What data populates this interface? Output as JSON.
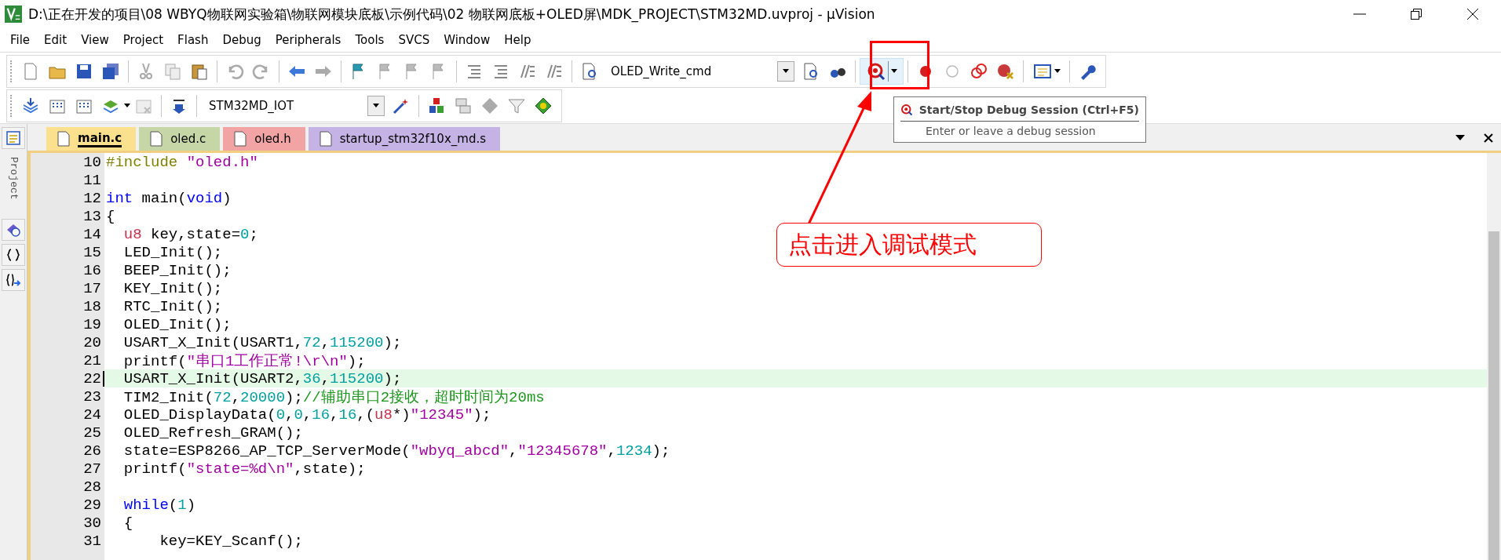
{
  "window": {
    "title": "D:\\正在开发的项目\\08 WBYQ物联网实验箱\\物联网模块底板\\示例代码\\02 物联网底板+OLED屏\\MDK_PROJECT\\STM32MD.uvproj - µVision"
  },
  "menu": [
    "File",
    "Edit",
    "View",
    "Project",
    "Flash",
    "Debug",
    "Peripherals",
    "Tools",
    "SVCS",
    "Window",
    "Help"
  ],
  "toolbar": {
    "find_combo": "OLED_Write_cmd",
    "debug_button": {
      "hovered": true
    }
  },
  "build_toolbar": {
    "target_combo": "STM32MD_IOT"
  },
  "side_panel": {
    "label": "Project"
  },
  "tabs": [
    {
      "label": "main.c",
      "selected": true,
      "color": "#fbe08e"
    },
    {
      "label": "oled.c",
      "selected": false,
      "color": "#c6d6a6"
    },
    {
      "label": "oled.h",
      "selected": false,
      "color": "#f2a4a4"
    },
    {
      "label": "startup_stm32f10x_md.s",
      "selected": false,
      "color": "#c6b3e6"
    }
  ],
  "editor": {
    "lines": [
      {
        "number": "10",
        "current": false,
        "tokens": [
          {
            "kind": "preproc",
            "text": "#include "
          },
          {
            "kind": "string",
            "text": "\"oled.h\""
          }
        ]
      },
      {
        "number": "11",
        "current": false
      },
      {
        "number": "12",
        "current": false,
        "tokens": [
          {
            "kind": "keyword",
            "text": "int"
          },
          {
            "kind": "plain",
            "text": " main("
          },
          {
            "kind": "keyword",
            "text": "void"
          },
          {
            "kind": "plain",
            "text": ")"
          }
        ]
      },
      {
        "number": "13",
        "current": false,
        "tokens": [
          {
            "kind": "plain",
            "text": "{"
          }
        ]
      },
      {
        "number": "14",
        "current": false,
        "tokens": [
          {
            "kind": "type",
            "text": "  u8"
          },
          {
            "kind": "plain",
            "text": " key,state="
          },
          {
            "kind": "number",
            "text": "0"
          },
          {
            "kind": "plain",
            "text": ";"
          }
        ]
      },
      {
        "number": "15",
        "current": false,
        "tokens": [
          {
            "kind": "plain",
            "text": "  LED_Init();"
          }
        ]
      },
      {
        "number": "16",
        "current": false,
        "tokens": [
          {
            "kind": "plain",
            "text": "  BEEP_Init();"
          }
        ]
      },
      {
        "number": "17",
        "current": false,
        "tokens": [
          {
            "kind": "plain",
            "text": "  KEY_Init();"
          }
        ]
      },
      {
        "number": "18",
        "current": false,
        "tokens": [
          {
            "kind": "plain",
            "text": "  RTC_Init();"
          }
        ]
      },
      {
        "number": "19",
        "current": false,
        "tokens": [
          {
            "kind": "plain",
            "text": "  OLED_Init();"
          }
        ]
      },
      {
        "number": "20",
        "current": false,
        "tokens": [
          {
            "kind": "plain",
            "text": "  USART_X_Init(USART1,"
          },
          {
            "kind": "number",
            "text": "72"
          },
          {
            "kind": "plain",
            "text": ","
          },
          {
            "kind": "number",
            "text": "115200"
          },
          {
            "kind": "plain",
            "text": ");"
          }
        ]
      },
      {
        "number": "21",
        "current": false,
        "tokens": [
          {
            "kind": "plain",
            "text": "  printf("
          },
          {
            "kind": "string",
            "text": "\"串口1工作正常!\\r\\n\""
          },
          {
            "kind": "plain",
            "text": ");"
          }
        ]
      },
      {
        "number": "22",
        "current": true,
        "tokens": [
          {
            "kind": "plain",
            "text": "  USART_X_Init(USART2,"
          },
          {
            "kind": "number",
            "text": "36"
          },
          {
            "kind": "plain",
            "text": ","
          },
          {
            "kind": "number",
            "text": "115200"
          },
          {
            "kind": "plain",
            "text": ");"
          }
        ]
      },
      {
        "number": "23",
        "current": false,
        "tokens": [
          {
            "kind": "plain",
            "text": "  TIM2_Init("
          },
          {
            "kind": "number",
            "text": "72"
          },
          {
            "kind": "plain",
            "text": ","
          },
          {
            "kind": "number",
            "text": "20000"
          },
          {
            "kind": "plain",
            "text": ");"
          },
          {
            "kind": "comment",
            "text": "//辅助串口2接收，超时时间为20ms"
          }
        ]
      },
      {
        "number": "24",
        "current": false,
        "tokens": [
          {
            "kind": "plain",
            "text": "  OLED_DisplayData("
          },
          {
            "kind": "number",
            "text": "0"
          },
          {
            "kind": "plain",
            "text": ","
          },
          {
            "kind": "number",
            "text": "0"
          },
          {
            "kind": "plain",
            "text": ","
          },
          {
            "kind": "number",
            "text": "16"
          },
          {
            "kind": "plain",
            "text": ","
          },
          {
            "kind": "number",
            "text": "16"
          },
          {
            "kind": "plain",
            "text": ",("
          },
          {
            "kind": "type",
            "text": "u8"
          },
          {
            "kind": "plain",
            "text": "*)"
          },
          {
            "kind": "string",
            "text": "\"12345\""
          },
          {
            "kind": "plain",
            "text": ");"
          }
        ]
      },
      {
        "number": "25",
        "current": false,
        "tokens": [
          {
            "kind": "plain",
            "text": "  OLED_Refresh_GRAM();"
          }
        ]
      },
      {
        "number": "26",
        "current": false,
        "tokens": [
          {
            "kind": "plain",
            "text": "  state=ESP8266_AP_TCP_ServerMode("
          },
          {
            "kind": "string",
            "text": "\"wbyq_abcd\""
          },
          {
            "kind": "plain",
            "text": ","
          },
          {
            "kind": "string",
            "text": "\"12345678\""
          },
          {
            "kind": "plain",
            "text": ","
          },
          {
            "kind": "number",
            "text": "1234"
          },
          {
            "kind": "plain",
            "text": ");"
          }
        ]
      },
      {
        "number": "27",
        "current": false,
        "tokens": [
          {
            "kind": "plain",
            "text": "  printf("
          },
          {
            "kind": "string",
            "text": "\"state=%d\\n\""
          },
          {
            "kind": "plain",
            "text": ",state);"
          }
        ]
      },
      {
        "number": "28",
        "current": false
      },
      {
        "number": "29",
        "current": false,
        "tokens": [
          {
            "kind": "keyword",
            "text": "  while"
          },
          {
            "kind": "plain",
            "text": "("
          },
          {
            "kind": "number",
            "text": "1"
          },
          {
            "kind": "plain",
            "text": ")"
          }
        ]
      },
      {
        "number": "30",
        "current": false,
        "tokens": [
          {
            "kind": "plain",
            "text": "  {"
          }
        ]
      },
      {
        "number": "31",
        "current": false,
        "tokens": [
          {
            "kind": "plain",
            "text": "      key=KEY_Scanf();"
          }
        ]
      }
    ]
  },
  "tooltip": {
    "title": "Start/Stop Debug Session (Ctrl+F5)",
    "description": "Enter or leave a debug session"
  },
  "annotation": {
    "text": "点击进入调试模式"
  }
}
